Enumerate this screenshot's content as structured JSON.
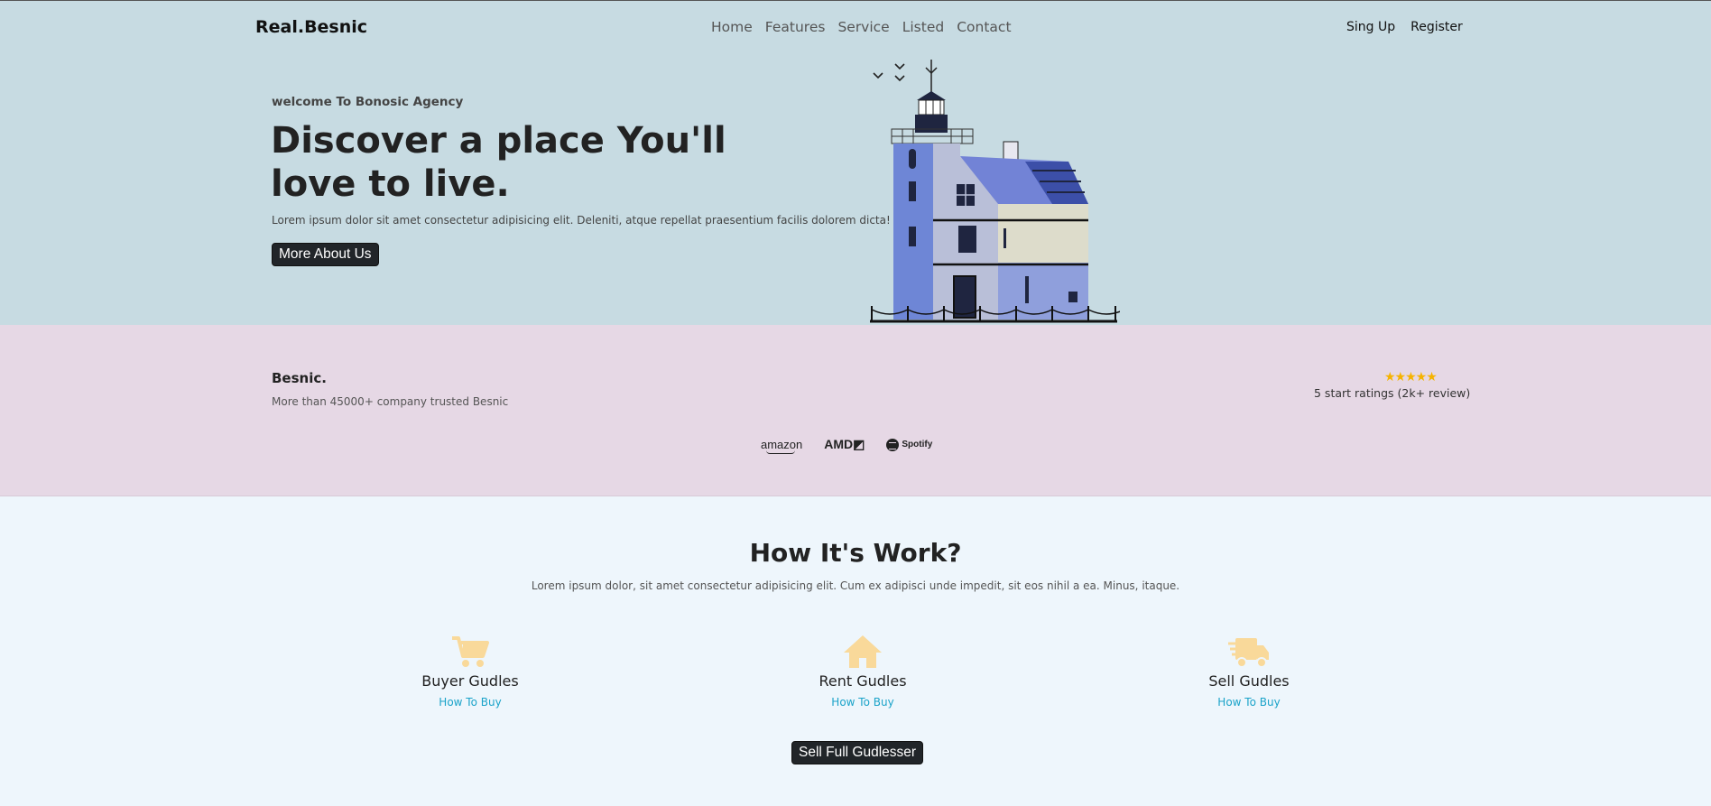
{
  "nav": {
    "brand": "Real.Besnic",
    "links": [
      "Home",
      "Features",
      "Service",
      "Listed",
      "Contact"
    ],
    "signup": "Sing Up",
    "register": "Register"
  },
  "hero": {
    "welcome": "welcome To Bonosic Agency",
    "headline": "Discover a place You'll love to live.",
    "lead": "Lorem ipsum dolor sit amet consectetur adipisicing elit. Deleniti, atque repellat praesentium facilis dolorem dicta!",
    "button": "More About Us"
  },
  "trust": {
    "title": "Besnic.",
    "subtitle": "More than 45000+ company trusted Besnic",
    "stars": "★★★★★",
    "rating_count": 5,
    "ratings_text": "5 start ratings (2k+ review)",
    "logos": [
      "amazon",
      "AMD",
      "Spotify"
    ]
  },
  "how": {
    "title": "How It's Work?",
    "subtitle": "Lorem ipsum dolor, sit amet consectetur adipisicing elit. Cum ex adipisci unde impedit, sit eos nihil a ea. Minus, itaque.",
    "features": [
      {
        "icon": "cart-icon",
        "title": "Buyer Gudles",
        "link": "How To Buy"
      },
      {
        "icon": "house-icon",
        "title": "Rent Gudles",
        "link": "How To Buy"
      },
      {
        "icon": "truck-icon",
        "title": "Sell Gudles",
        "link": "How To Buy"
      }
    ],
    "button": "Sell Full Gudlesser"
  },
  "colors": {
    "hero_bg": "#c7dbe2",
    "trust_bg": "#e6d8e5",
    "page_bg": "#eef6fc",
    "accent_link": "#1aa3c9",
    "icon_color": "#f9d99a",
    "star_color": "#f5b301"
  }
}
